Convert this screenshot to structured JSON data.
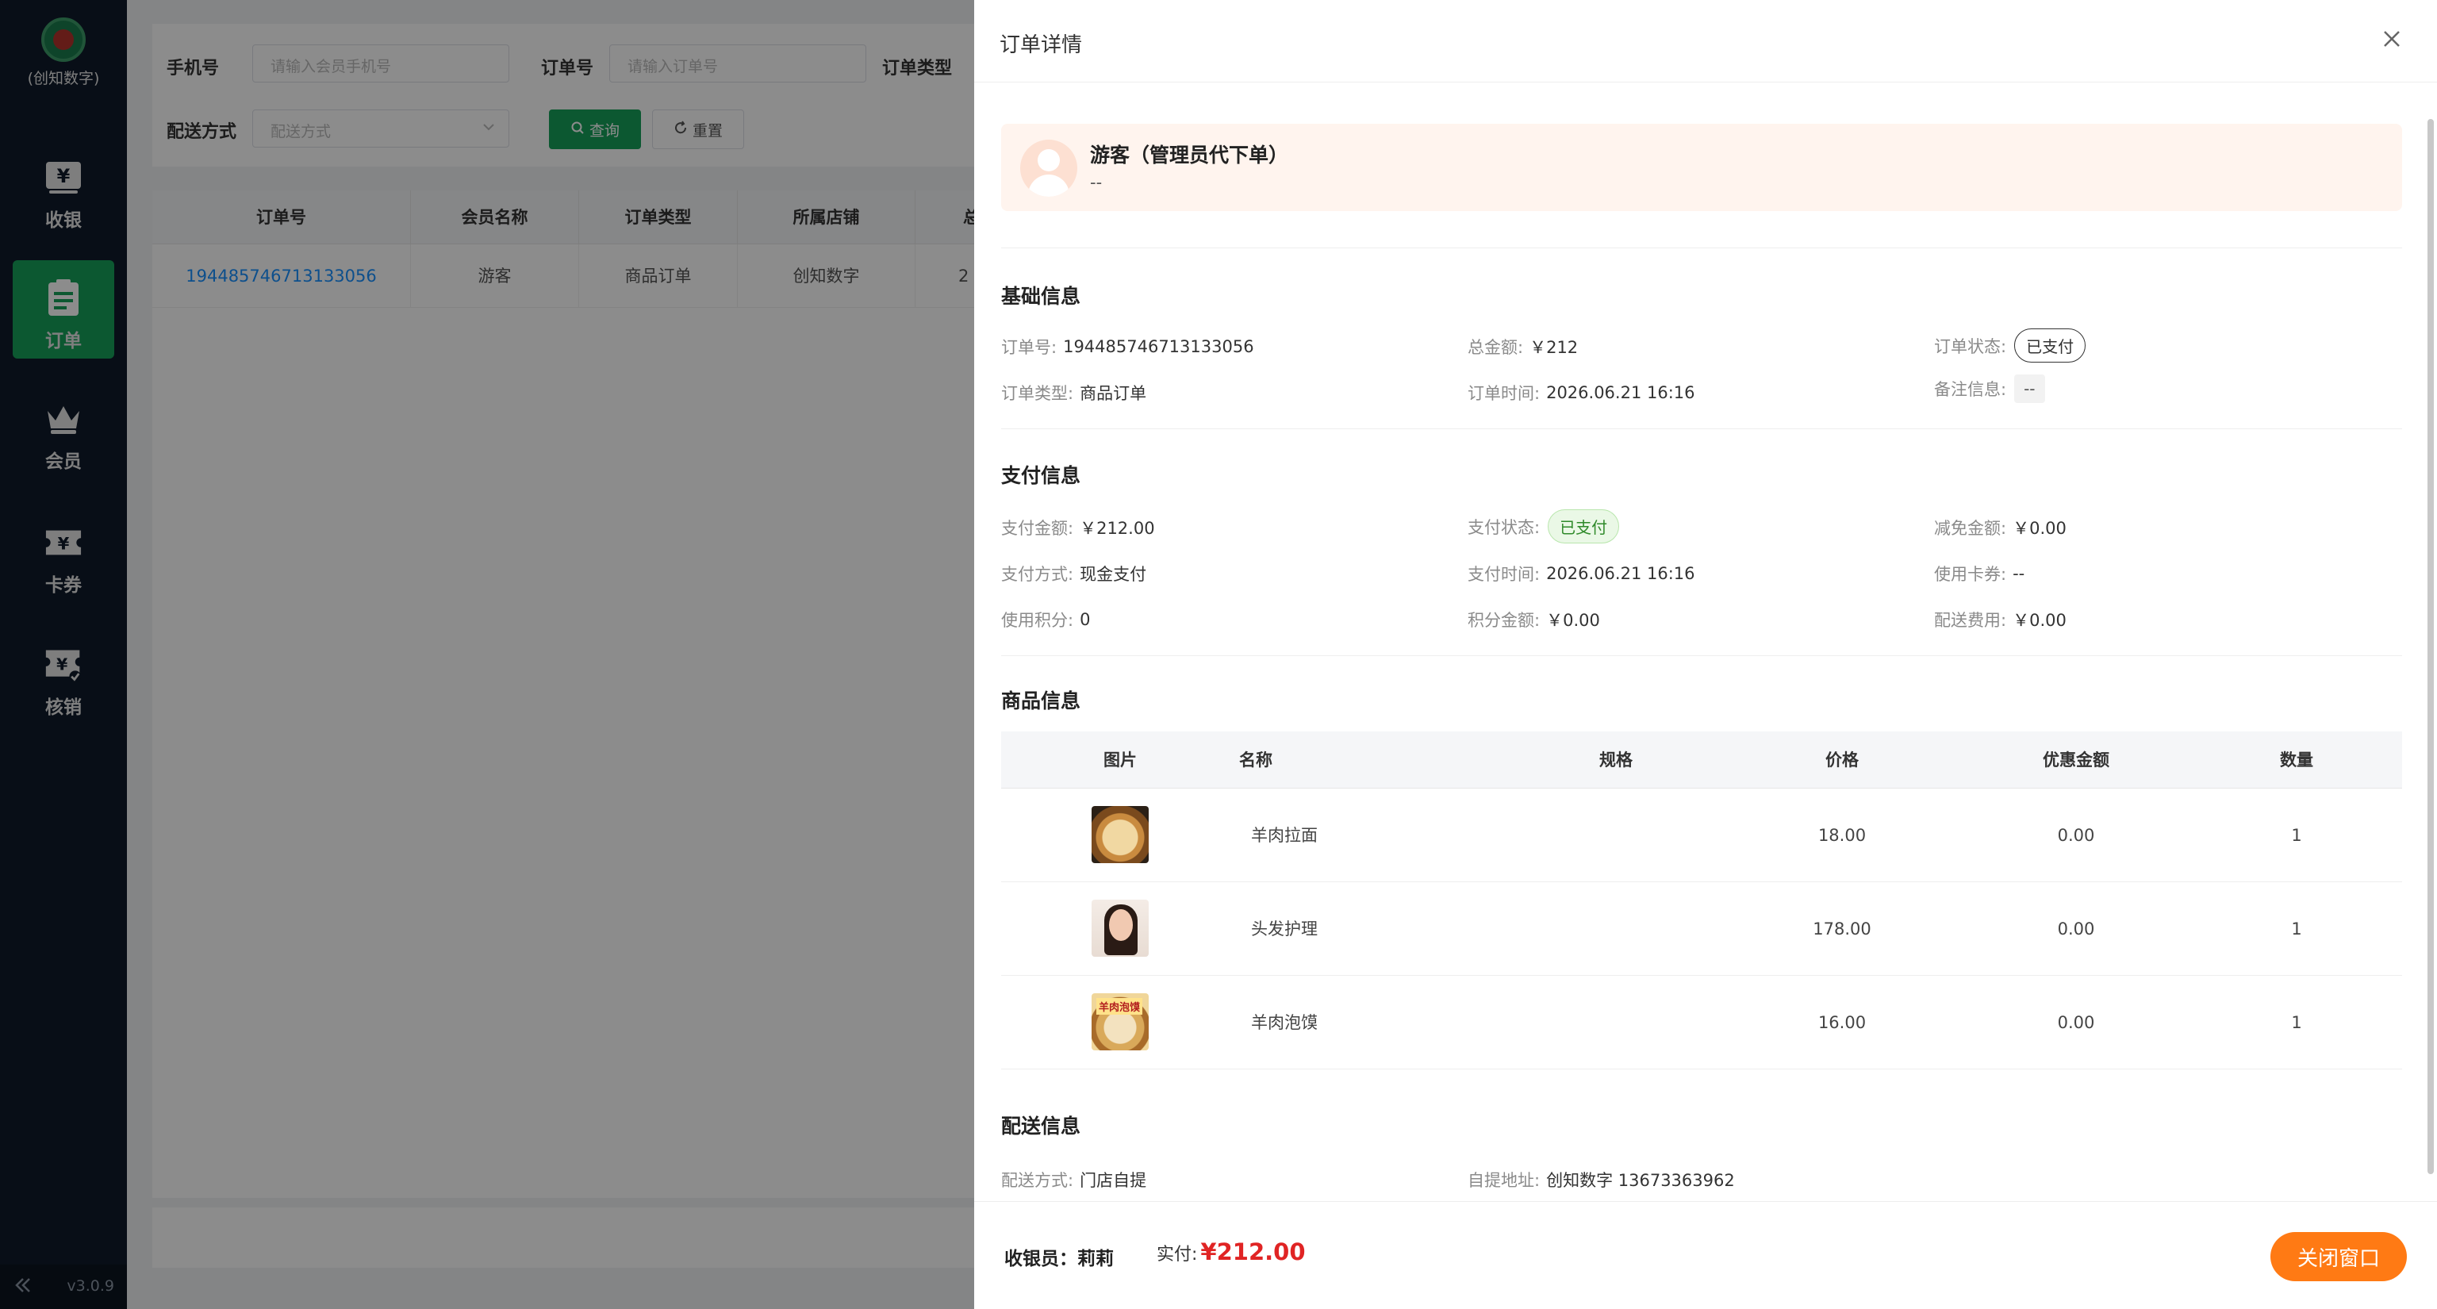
{
  "sidebar": {
    "brand": "(创知数字)",
    "items": [
      {
        "label": "收银",
        "icon": "cashier-icon"
      },
      {
        "label": "订单",
        "icon": "order-icon"
      },
      {
        "label": "会员",
        "icon": "crown-icon"
      },
      {
        "label": "卡券",
        "icon": "coupon-icon"
      },
      {
        "label": "核销",
        "icon": "verify-icon"
      }
    ],
    "version": "v3.0.9"
  },
  "filters": {
    "phone_label": "手机号",
    "phone_placeholder": "请输入会员手机号",
    "order_no_label": "订单号",
    "order_no_placeholder": "请输入订单号",
    "order_type_label": "订单类型",
    "delivery_label": "配送方式",
    "delivery_placeholder": "配送方式",
    "query_label": "查询",
    "reset_label": "重置"
  },
  "orders_table": {
    "columns": [
      "订单号",
      "会员名称",
      "订单类型",
      "所属店铺",
      "总"
    ],
    "rows": [
      {
        "order_no": "194485746713133056",
        "member": "游客",
        "type": "商品订单",
        "store": "创知数字",
        "total": "2"
      }
    ]
  },
  "drawer": {
    "title": "订单详情",
    "customer": {
      "name": "游客（管理员代下单）",
      "phone": "--"
    },
    "basic": {
      "title": "基础信息",
      "order_no_label": "订单号:",
      "order_no": "194485746713133056",
      "total_label": "总金额:",
      "total": "￥212",
      "status_label": "订单状态:",
      "status": "已支付",
      "type_label": "订单类型:",
      "type": "商品订单",
      "time_label": "订单时间:",
      "time": "2026.06.21 16:16",
      "remark_label": "备注信息:",
      "remark": "--"
    },
    "payment": {
      "title": "支付信息",
      "amount_label": "支付金额:",
      "amount": "￥212.00",
      "status_label": "支付状态:",
      "status": "已支付",
      "discount_label": "减免金额:",
      "discount": "￥0.00",
      "method_label": "支付方式:",
      "method": "现金支付",
      "time_label": "支付时间:",
      "time": "2026.06.21 16:16",
      "coupon_label": "使用卡券:",
      "coupon": "--",
      "points_label": "使用积分:",
      "points": "0",
      "points_amount_label": "积分金额:",
      "points_amount": "￥0.00",
      "delivery_fee_label": "配送费用:",
      "delivery_fee": "￥0.00"
    },
    "goods": {
      "title": "商品信息",
      "columns": [
        "图片",
        "名称",
        "规格",
        "价格",
        "优惠金额",
        "数量"
      ],
      "rows": [
        {
          "name": "羊肉拉面",
          "spec": "",
          "price": "18.00",
          "discount": "0.00",
          "qty": "1"
        },
        {
          "name": "头发护理",
          "spec": "",
          "price": "178.00",
          "discount": "0.00",
          "qty": "1"
        },
        {
          "name": "羊肉泡馍",
          "spec": "",
          "price": "16.00",
          "discount": "0.00",
          "qty": "1",
          "badge": "羊肉泡馍"
        }
      ]
    },
    "delivery": {
      "title": "配送信息",
      "method_label": "配送方式:",
      "method": "门店自提",
      "address_label": "自提地址:",
      "address": "创知数字 13673363962"
    },
    "footer": {
      "cashier_label": "收银员：",
      "cashier": "莉莉",
      "paid_label": "实付:",
      "paid": "¥212.00",
      "close_label": "关闭窗口"
    }
  },
  "colors": {
    "primary": "#16a05a",
    "accent": "#ff7a14",
    "price": "#e02424",
    "sidebar": "#0f1a2a"
  }
}
